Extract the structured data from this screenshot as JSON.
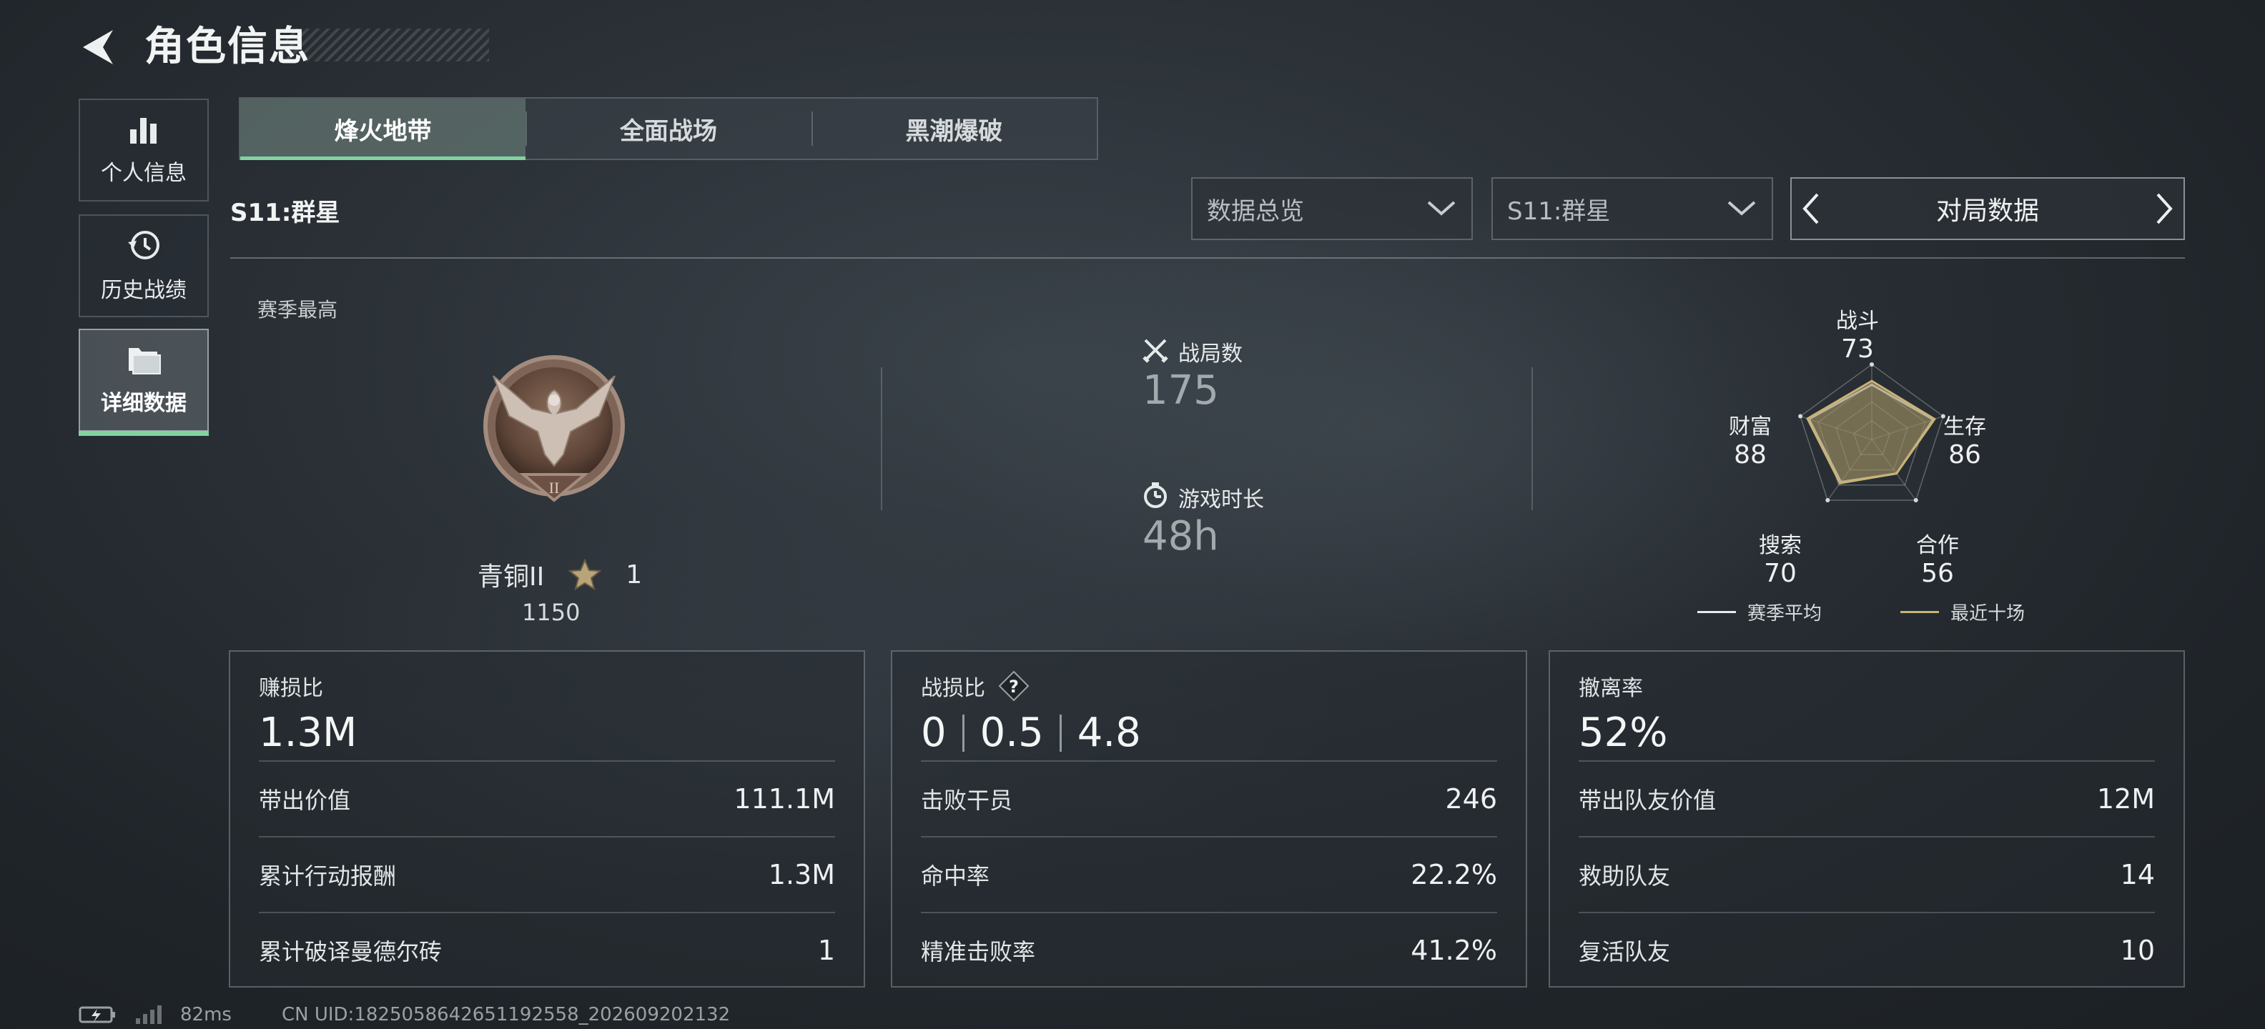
{
  "header": {
    "title": "角色信息"
  },
  "sidebar": {
    "items": [
      {
        "label": "个人信息",
        "icon": "bar-chart-icon"
      },
      {
        "label": "历史战绩",
        "icon": "history-icon"
      },
      {
        "label": "详细数据",
        "icon": "folder-icon",
        "active": true
      }
    ]
  },
  "tabs": [
    {
      "label": "烽火地带",
      "active": true
    },
    {
      "label": "全面战场"
    },
    {
      "label": "黑潮爆破"
    }
  ],
  "season_title": "S11:群星",
  "filters": {
    "dropdown1": "数据总览",
    "dropdown2": "S11:群星",
    "navigator": "对局数据"
  },
  "season_best": {
    "label": "赛季最高",
    "rank_name": "青铜II",
    "stars": "1",
    "score": "1150"
  },
  "overview": {
    "matches_label": "战局数",
    "matches_value": "175",
    "playtime_label": "游戏时长",
    "playtime_value": "48h"
  },
  "radar": {
    "axes": [
      {
        "name": "战斗",
        "value": "73"
      },
      {
        "name": "生存",
        "value": "86"
      },
      {
        "name": "合作",
        "value": "56"
      },
      {
        "name": "搜索",
        "value": "70"
      },
      {
        "name": "财富",
        "value": "88"
      }
    ],
    "season_avg": [
      73,
      86,
      56,
      70,
      88
    ],
    "recent_ten": [
      78,
      88,
      56,
      72,
      90
    ],
    "legend": {
      "season_avg": "赛季平均",
      "recent_ten": "最近十场"
    },
    "colors": {
      "season_avg": "#e8ebec",
      "recent_ten": "#c9b274"
    }
  },
  "cards": [
    {
      "title": "赚损比",
      "big": "1.3M",
      "rows": [
        {
          "label": "带出价值",
          "value": "111.1M"
        },
        {
          "label": "累计行动报酬",
          "value": "1.3M"
        },
        {
          "label": "累计破译曼德尔砖",
          "value": "1"
        }
      ]
    },
    {
      "title": "战损比",
      "ratio": [
        "0",
        "0.5",
        "4.8"
      ],
      "rows": [
        {
          "label": "击败干员",
          "value": "246"
        },
        {
          "label": "命中率",
          "value": "22.2%"
        },
        {
          "label": "精准击败率",
          "value": "41.2%"
        }
      ]
    },
    {
      "title": "撤离率",
      "big": "52%",
      "rows": [
        {
          "label": "带出队友价值",
          "value": "12M"
        },
        {
          "label": "救助队友",
          "value": "14"
        },
        {
          "label": "复活队友",
          "value": "10"
        }
      ]
    }
  ],
  "footer": {
    "ping": "82ms",
    "uid": "CN UID:1825058642651192558_202609202132"
  },
  "colors": {
    "accent": "#7fd4a2",
    "gold": "#c9b274"
  }
}
